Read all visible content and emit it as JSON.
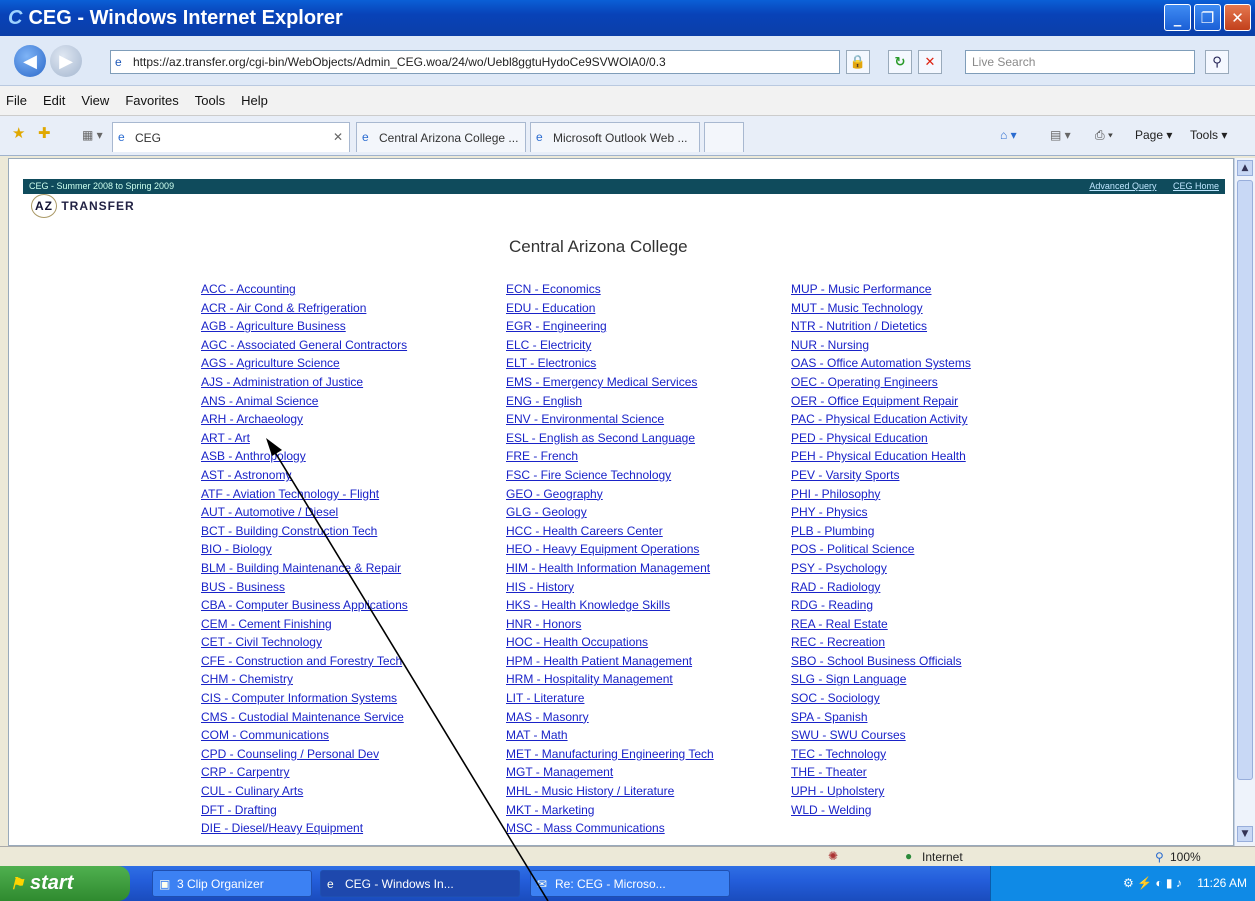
{
  "window": {
    "title": "CEG - Windows Internet Explorer",
    "logo": "C"
  },
  "window_buttons": {
    "minimize": "_",
    "maximize": "❐",
    "close": "✕"
  },
  "address": {
    "url": "https://az.transfer.org/cgi-bin/WebObjects/Admin_CEG.woa/24/wo/Uebl8ggtuHydoCe9SVWOlA0/0.3",
    "search_placeholder": "Live Search"
  },
  "menu": [
    "File",
    "Edit",
    "View",
    "Favorites",
    "Tools",
    "Help"
  ],
  "tabs": [
    {
      "label": "CEG",
      "active": true
    },
    {
      "label": "Central Arizona College ..."
    },
    {
      "label": "Microsoft Outlook Web ..."
    }
  ],
  "command_bar": {
    "page": "Page",
    "tools": "Tools"
  },
  "page": {
    "header_left": "CEG - Summer 2008 to Spring 2009",
    "header_links": [
      "Advanced Query",
      "CEG Home"
    ],
    "logo_az": "AZ",
    "logo_transfer": "TRANSFER",
    "college_title": "Central Arizona College"
  },
  "columns": [
    [
      "ACC - Accounting",
      "ACR - Air Cond & Refrigeration",
      "AGB - Agriculture Business",
      "AGC - Associated General Contractors",
      "AGS - Agriculture Science",
      "AJS - Administration of Justice",
      "ANS - Animal Science",
      "ARH - Archaeology",
      "ART - Art",
      "ASB - Anthropology",
      "AST - Astronomy",
      "ATF - Aviation Technology - Flight",
      "AUT - Automotive / Diesel",
      "BCT - Building Construction Tech",
      "BIO - Biology",
      "BLM - Building Maintenance & Repair",
      "BUS - Business",
      "CBA - Computer Business Applications",
      "CEM - Cement Finishing",
      "CET - Civil Technology",
      "CFE - Construction and Forestry Tech",
      "CHM - Chemistry",
      "CIS - Computer Information Systems",
      "CMS - Custodial Maintenance Service",
      "COM - Communications",
      "CPD - Counseling / Personal Dev",
      "CRP - Carpentry",
      "CUL - Culinary Arts",
      "DFT - Drafting",
      "DIE - Diesel/Heavy Equipment"
    ],
    [
      "ECN - Economics",
      "EDU - Education",
      "EGR - Engineering",
      "ELC - Electricity",
      "ELT - Electronics",
      "EMS - Emergency Medical Services",
      "ENG - English",
      "ENV - Environmental Science",
      "ESL - English as Second Language",
      "FRE - French",
      "FSC - Fire Science Technology",
      "GEO - Geography",
      "GLG - Geology",
      "HCC - Health Careers Center",
      "HEO - Heavy Equipment Operations",
      "HIM - Health Information Management",
      "HIS - History",
      "HKS - Health Knowledge Skills",
      "HNR - Honors",
      "HOC - Health Occupations",
      "HPM - Health Patient Management",
      "HRM - Hospitality Management",
      "LIT - Literature",
      "MAS - Masonry",
      "MAT - Math",
      "MET - Manufacturing Engineering Tech",
      "MGT - Management",
      "MHL - Music History / Literature",
      "MKT - Marketing",
      "MSC - Mass Communications"
    ],
    [
      "MUP - Music Performance",
      "MUT - Music Technology",
      "NTR - Nutrition / Dietetics",
      "NUR - Nursing",
      "OAS - Office Automation Systems",
      "OEC - Operating Engineers",
      "OER - Office Equipment Repair",
      "PAC - Physical Education Activity",
      "PED - Physical Education",
      "PEH - Physical Education Health",
      "PEV - Varsity Sports",
      "PHI - Philosophy",
      "PHY - Physics",
      "PLB - Plumbing",
      "POS - Political Science",
      "PSY - Psychology",
      "RAD - Radiology",
      "RDG - Reading",
      "REA - Real Estate",
      "REC - Recreation",
      "SBO - School Business Officials",
      "SLG - Sign Language",
      "SOC - Sociology",
      "SPA - Spanish",
      "SWU - SWU Courses",
      "TEC - Technology",
      "THE - Theater",
      "UPH - Upholstery",
      "WLD - Welding"
    ]
  ],
  "status": {
    "zone": "Internet",
    "zoom": "100%"
  },
  "taskbar": {
    "start": "start",
    "items": [
      "3 Clip Organizer",
      "CEG - Windows In...",
      "Re: CEG - Microso..."
    ],
    "clock": "11:26 AM"
  }
}
